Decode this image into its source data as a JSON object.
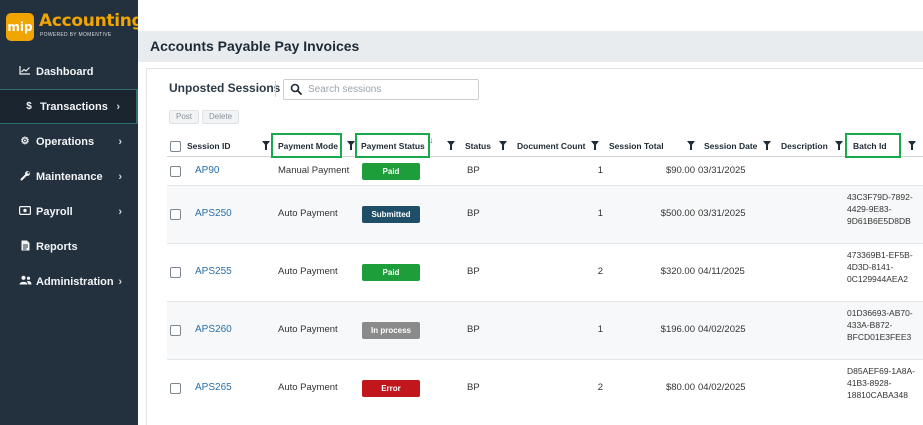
{
  "app": {
    "logo_badge": "mip",
    "logo_title": "Accounting",
    "logo_subtitle": "POWERED BY MOMENTIVE"
  },
  "sidebar": {
    "items": [
      {
        "label": "Dashboard",
        "icon": "chart-line-icon",
        "chevron": false
      },
      {
        "label": "Transactions",
        "icon": "dollar-icon",
        "chevron": true,
        "active": true
      },
      {
        "label": "Operations",
        "icon": "gears-icon",
        "chevron": true
      },
      {
        "label": "Maintenance",
        "icon": "wrench-icon",
        "chevron": true
      },
      {
        "label": "Payroll",
        "icon": "money-icon",
        "chevron": true
      },
      {
        "label": "Reports",
        "icon": "file-icon",
        "chevron": false
      },
      {
        "label": "Administration",
        "icon": "users-icon",
        "chevron": true
      }
    ]
  },
  "page": {
    "title": "Accounts Payable Pay Invoices"
  },
  "card": {
    "title": "Unposted Sessions",
    "search_placeholder": "Search sessions",
    "post_label": "Post",
    "delete_label": "Delete"
  },
  "table": {
    "columns": {
      "session_id": "Session ID",
      "payment_mode": "Payment Mode",
      "payment_status": "Payment Status",
      "status": "Status",
      "document_count": "Document Count",
      "session_total": "Session Total",
      "session_date": "Session Date",
      "description": "Description",
      "batch_id": "Batch Id"
    },
    "highlighted_columns": [
      "Payment Mode",
      "Payment Status",
      "Batch Id"
    ],
    "highlight_color": "#19a84c",
    "rows": [
      {
        "session_id": "AP90",
        "payment_mode": "Manual Payment",
        "payment_status": "Paid",
        "status_color": "#1e9e3a",
        "status": "BP",
        "document_count": "1",
        "session_total": "$90.00",
        "session_date": "03/31/2025",
        "description": "",
        "batch_id": ""
      },
      {
        "session_id": "APS250",
        "payment_mode": "Auto Payment",
        "payment_status": "Submitted",
        "status_color": "#1f4e69",
        "status": "BP",
        "document_count": "1",
        "session_total": "$500.00",
        "session_date": "03/31/2025",
        "description": "",
        "batch_id": "43C3F79D-7892-4429-9E83-9D61B6E5D8DB"
      },
      {
        "session_id": "APS255",
        "payment_mode": "Auto Payment",
        "payment_status": "Paid",
        "status_color": "#1e9e3a",
        "status": "BP",
        "document_count": "2",
        "session_total": "$320.00",
        "session_date": "04/11/2025",
        "description": "",
        "batch_id": "473369B1-EF5B-4D3D-8141-0C129944AEA2"
      },
      {
        "session_id": "APS260",
        "payment_mode": "Auto Payment",
        "payment_status": "In process",
        "status_color": "#8a8a8a",
        "status": "BP",
        "document_count": "1",
        "session_total": "$196.00",
        "session_date": "04/02/2025",
        "description": "",
        "batch_id": "01D36693-AB70-433A-B872-BFCD01E3FEE3"
      },
      {
        "session_id": "APS265",
        "payment_mode": "Auto Payment",
        "payment_status": "Error",
        "status_color": "#c0161c",
        "status": "BP",
        "document_count": "2",
        "session_total": "$80.00",
        "session_date": "04/02/2025",
        "description": "",
        "batch_id": "D85AEF69-1A8A-41B3-8928-18810CABA348"
      }
    ]
  }
}
